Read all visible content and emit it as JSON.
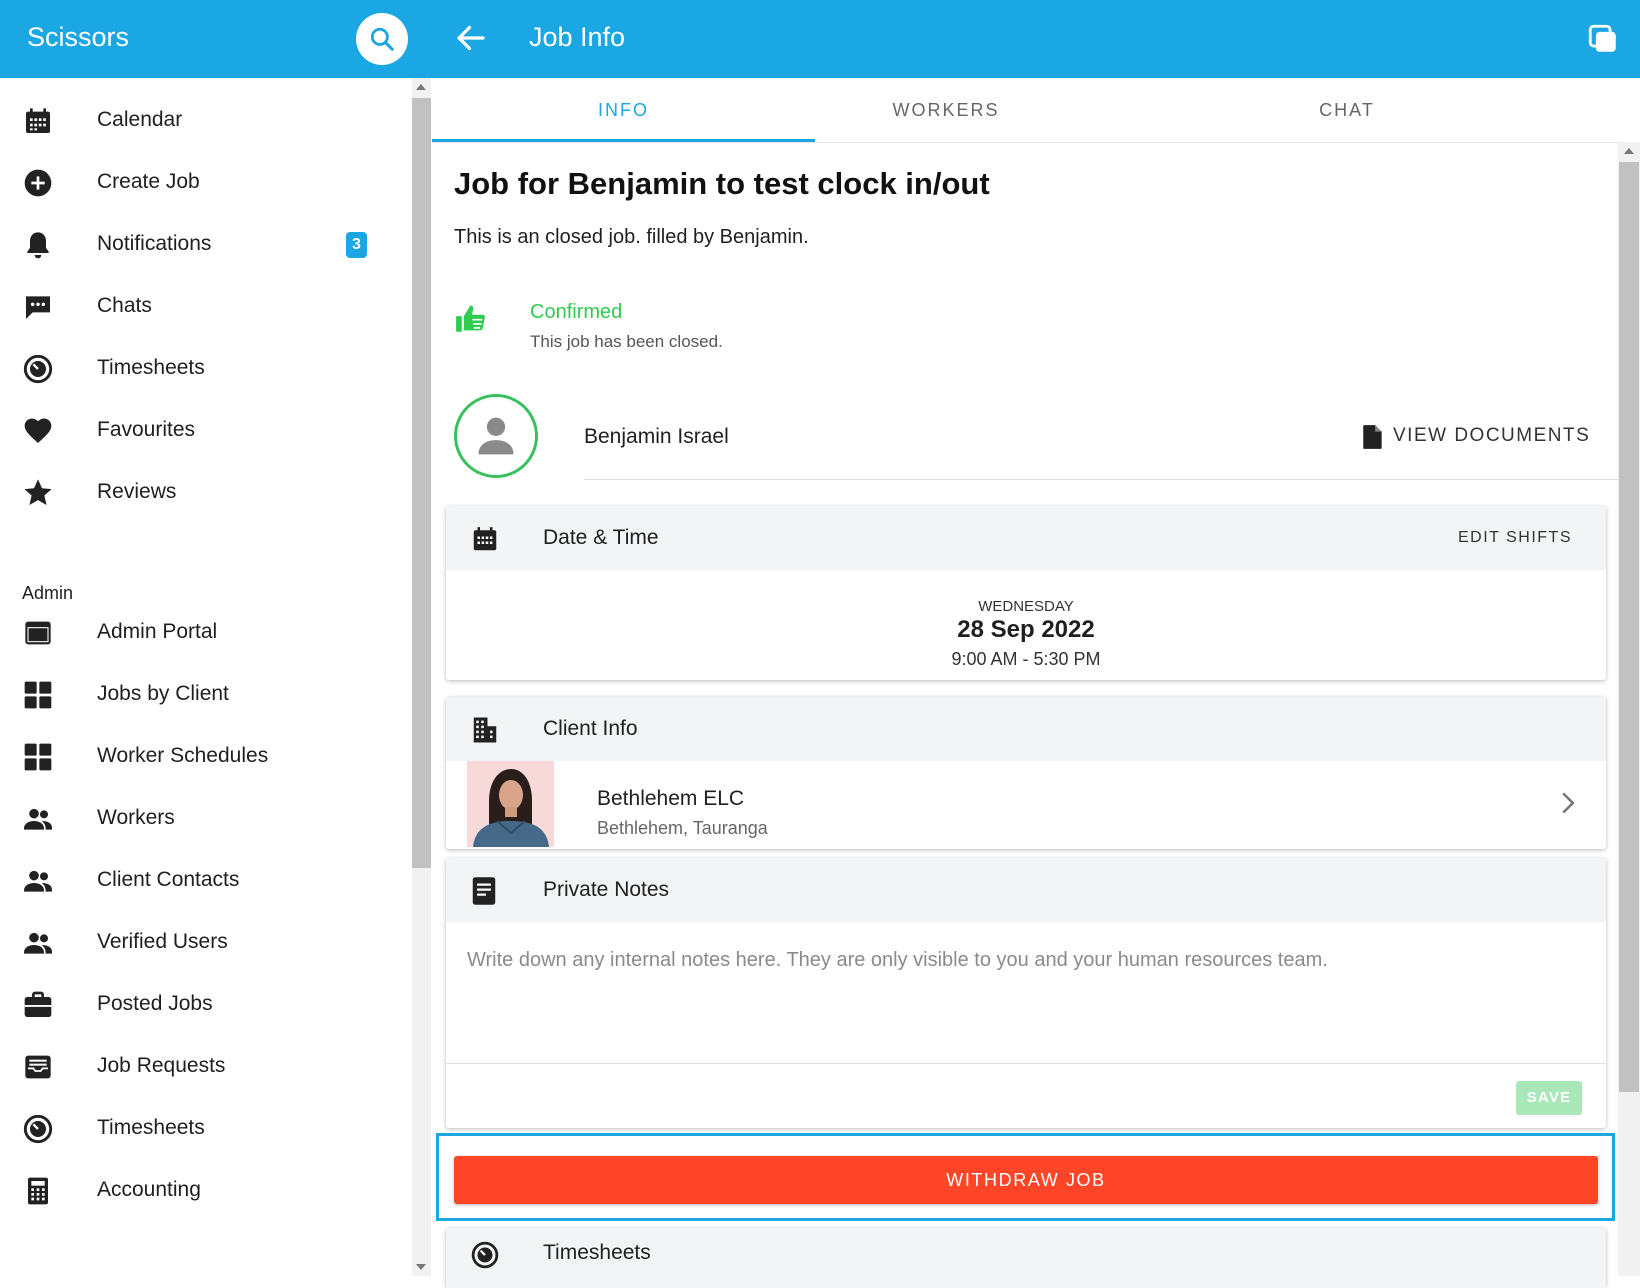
{
  "header": {
    "app_title": "Scissors",
    "page_title": "Job Info",
    "brand_color": "#1aa7e4"
  },
  "sidebar": {
    "items": [
      {
        "label": "Calendar",
        "icon": "calendar-icon"
      },
      {
        "label": "Create Job",
        "icon": "add-circle-icon"
      },
      {
        "label": "Notifications",
        "icon": "bell-icon",
        "badge": "3"
      },
      {
        "label": "Chats",
        "icon": "chat-icon"
      },
      {
        "label": "Timesheets",
        "icon": "timer-icon"
      },
      {
        "label": "Favourites",
        "icon": "heart-icon"
      },
      {
        "label": "Reviews",
        "icon": "star-icon"
      }
    ],
    "section_label": "Admin",
    "admin_items": [
      {
        "label": "Admin Portal",
        "icon": "browser-window-icon"
      },
      {
        "label": "Jobs by Client",
        "icon": "grid-icon"
      },
      {
        "label": "Worker Schedules",
        "icon": "grid-icon"
      },
      {
        "label": "Workers",
        "icon": "people-icon"
      },
      {
        "label": "Client Contacts",
        "icon": "people-icon"
      },
      {
        "label": "Verified Users",
        "icon": "people-icon"
      },
      {
        "label": "Posted Jobs",
        "icon": "briefcase-icon"
      },
      {
        "label": "Job Requests",
        "icon": "inbox-icon"
      },
      {
        "label": "Timesheets",
        "icon": "timer-icon"
      },
      {
        "label": "Accounting",
        "icon": "calculator-icon"
      }
    ]
  },
  "tabs": [
    {
      "label": "INFO",
      "active": true
    },
    {
      "label": "WORKERS",
      "active": false
    },
    {
      "label": "CHAT",
      "active": false
    }
  ],
  "job": {
    "title": "Job for Benjamin to test clock in/out",
    "description": "This is an closed job. filled by Benjamin.",
    "status_title": "Confirmed",
    "status_subtitle": "This job has been closed.",
    "status_color": "#2ecc4f"
  },
  "worker": {
    "name": "Benjamin Israel",
    "view_documents_label": "VIEW DOCUMENTS"
  },
  "date_time": {
    "title": "Date & Time",
    "edit_label": "EDIT SHIFTS",
    "weekday": "WEDNESDAY",
    "date": "28 Sep 2022",
    "time_range": "9:00 AM - 5:30 PM"
  },
  "client": {
    "title": "Client Info",
    "name": "Bethlehem ELC",
    "location": "Bethlehem, Tauranga"
  },
  "notes": {
    "title": "Private Notes",
    "placeholder": "Write down any internal notes here. They are only visible to you and your human resources team.",
    "save_label": "SAVE"
  },
  "actions": {
    "withdraw_label": "WITHDRAW JOB",
    "withdraw_color": "#ff4527"
  },
  "timesheets": {
    "title": "Timesheets"
  }
}
